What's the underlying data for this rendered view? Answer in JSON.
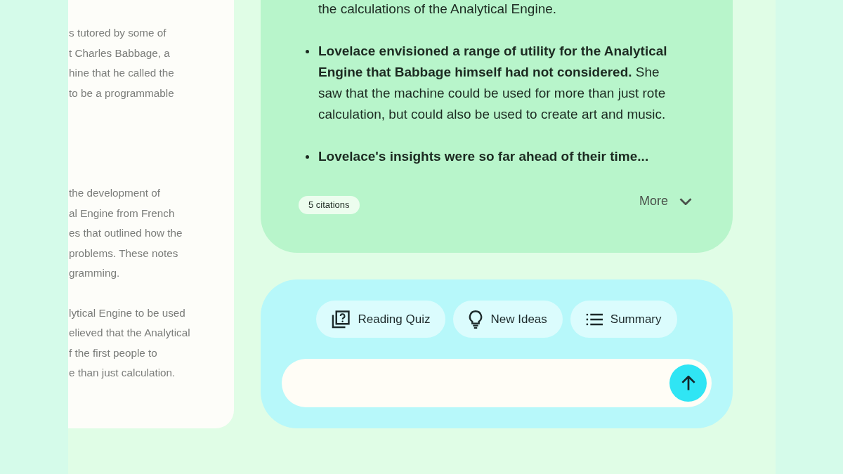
{
  "document_panel": {
    "paragraphs": [
      {
        "lines": [
          "s tutored by some of",
          "t Charles Babbage, a",
          "hine that he called the",
          "to be a programmable"
        ]
      },
      {
        "lines": [
          "the development of",
          "al Engine from French",
          "es that outlined how the",
          "problems. These notes",
          "gramming."
        ]
      },
      {
        "lines": [
          "lytical Engine to be used",
          "elieved that the Analytical",
          "f the first people to",
          "e than just calculation."
        ]
      }
    ]
  },
  "response_card": {
    "items": [
      {
        "kind": "continuation",
        "text": "the calculations of the Analytical Engine."
      },
      {
        "kind": "bullet",
        "text": "**Lovelace envisioned a range of utility for the Analytical Engine that Babbage himself had not considered.** She saw that the machine could be used for more than just rote calculation, but could also be used to create art and music."
      },
      {
        "kind": "bullet",
        "text": "**Lovelace's insights were so far ahead of their time...**"
      }
    ],
    "citations": "5 citations",
    "more_button": "More"
  },
  "prompt_panel": {
    "suggestions": [
      {
        "kind": "quiz",
        "label": "Reading Quiz"
      },
      {
        "kind": "ideas",
        "label": "New Ideas"
      },
      {
        "kind": "summary",
        "label": "Summary"
      }
    ]
  }
}
